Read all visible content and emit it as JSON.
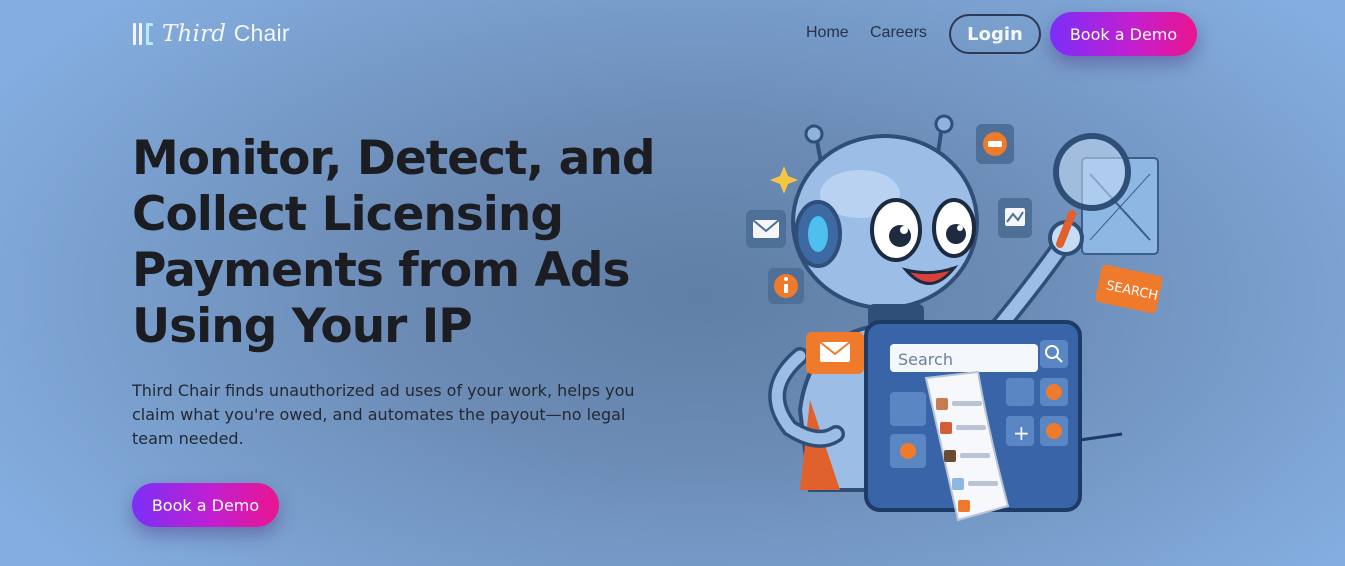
{
  "nav": {
    "brand_italic": "Third",
    "brand_regular": "Chair",
    "links": [
      "Home",
      "Careers"
    ],
    "login_label": "Login",
    "demo_label": "Book a Demo"
  },
  "hero": {
    "title": "Monitor, Detect, and Collect Licensing Payments from Ads Using Your IP",
    "subtitle": "Third Chair finds unauthorized ad uses of your work, helps you claim what you're owed, and automates the payout—no legal team needed.",
    "cta_label": "Book a Demo"
  },
  "illustration": {
    "search_placeholder": "Search",
    "search_tag": "SEARCH",
    "icons": [
      "robot-mascot",
      "magnifier-icon",
      "mail-icon",
      "info-icon",
      "chat-icon",
      "image-icon",
      "plus-icon",
      "sparkle-icon"
    ]
  },
  "colors": {
    "cta_gradient_start": "#7b2ff7",
    "cta_gradient_end": "#e9158f",
    "title_text": "#1c1d22",
    "background": "#6c8cb6",
    "accent_orange": "#f07a2c"
  }
}
